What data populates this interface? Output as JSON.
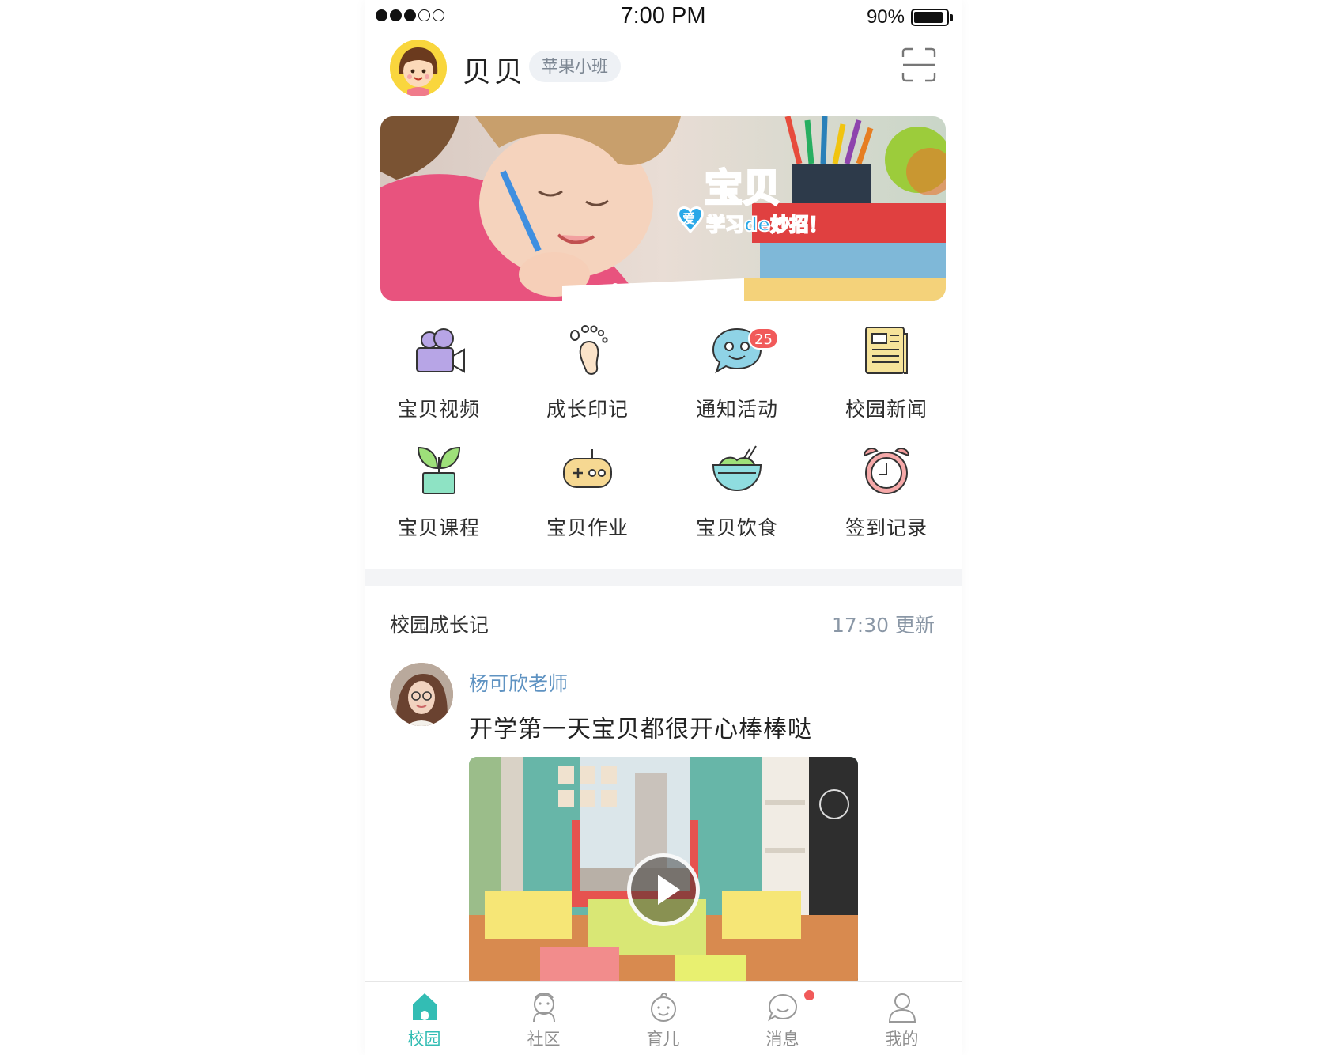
{
  "status_bar": {
    "time": "7:00 PM",
    "battery_percent": "90%",
    "battery_level": 0.9,
    "signal_strength": 3,
    "signal_total": 5
  },
  "header": {
    "user_name": "贝贝",
    "class_name": "苹果小班"
  },
  "banner": {
    "title": "宝贝",
    "subtitle": "学习de妙招！",
    "badge_text": "爱"
  },
  "grid": {
    "items": [
      {
        "label": "宝贝视频",
        "icon": "video-camera-icon"
      },
      {
        "label": "成长印记",
        "icon": "footprint-icon"
      },
      {
        "label": "通知活动",
        "icon": "chat-bubble-icon",
        "badge": "25"
      },
      {
        "label": "校园新闻",
        "icon": "newspaper-icon"
      },
      {
        "label": "宝贝课程",
        "icon": "sprout-icon"
      },
      {
        "label": "宝贝作业",
        "icon": "gamepad-icon"
      },
      {
        "label": "宝贝饮食",
        "icon": "food-bowl-icon"
      },
      {
        "label": "签到记录",
        "icon": "alarm-clock-icon"
      }
    ]
  },
  "feed": {
    "title": "校园成长记",
    "updated": "17:30 更新",
    "post": {
      "author": "杨可欣老师",
      "text": "开学第一天宝贝都很开心棒棒哒"
    }
  },
  "tabbar": {
    "tabs": [
      {
        "label": "校园",
        "icon": "school-home-icon",
        "active": true
      },
      {
        "label": "社区",
        "icon": "community-icon"
      },
      {
        "label": "育儿",
        "icon": "baby-face-icon"
      },
      {
        "label": "消息",
        "icon": "message-icon",
        "unread_dot": true
      },
      {
        "label": "我的",
        "icon": "profile-icon"
      }
    ]
  },
  "colors": {
    "accent": "#33bdb4",
    "badge_red": "#f15a5a",
    "link_blue": "#5f93c2",
    "muted": "#8a97a6"
  }
}
